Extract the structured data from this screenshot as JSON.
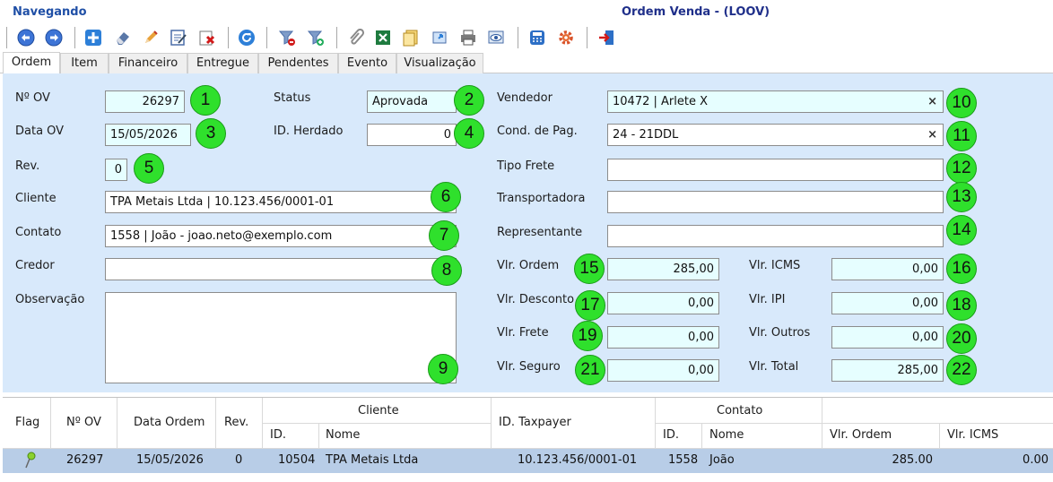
{
  "header": {
    "mode": "Navegando",
    "window_title": "Ordem Venda - (LOOV)"
  },
  "toolbar": {
    "buttons": [
      {
        "name": "back-arrow-icon"
      },
      {
        "name": "forward-arrow-icon"
      },
      {
        "name": "add-icon"
      },
      {
        "name": "eraser-icon"
      },
      {
        "name": "pencil-icon"
      },
      {
        "name": "edit-checklist-icon"
      },
      {
        "name": "delete-icon"
      },
      {
        "name": "refresh-icon"
      },
      {
        "name": "filter-remove-icon"
      },
      {
        "name": "filter-add-icon"
      },
      {
        "name": "paperclip-icon"
      },
      {
        "name": "excel-icon"
      },
      {
        "name": "documents-icon"
      },
      {
        "name": "transfer-icon"
      },
      {
        "name": "printer-icon"
      },
      {
        "name": "preview-icon"
      },
      {
        "name": "calculator-icon"
      },
      {
        "name": "gear-icon"
      },
      {
        "name": "exit-icon"
      }
    ]
  },
  "tabs": [
    "Ordem",
    "Item",
    "Financeiro",
    "Entregue",
    "Pendentes",
    "Evento",
    "Visualização"
  ],
  "form": {
    "no_ov": {
      "label": "Nº OV",
      "value": "26297",
      "badge": "1"
    },
    "status": {
      "label": "Status",
      "value": "Aprovada",
      "badge": "2"
    },
    "data_ov": {
      "label": "Data OV",
      "value": "15/05/2026",
      "badge": "3"
    },
    "id_herdado": {
      "label": "ID. Herdado",
      "value": "0",
      "badge": "4"
    },
    "rev": {
      "label": "Rev.",
      "value": "0",
      "badge": "5"
    },
    "cliente": {
      "label": "Cliente",
      "value": "TPA Metais Ltda | 10.123.456/0001-01",
      "badge": "6"
    },
    "contato": {
      "label": "Contato",
      "value": "1558 | João - joao.neto@exemplo.com",
      "badge": "7"
    },
    "credor": {
      "label": "Credor",
      "value": "",
      "badge": "8"
    },
    "observacao": {
      "label": "Observação",
      "value": "",
      "badge": "9"
    },
    "vendedor": {
      "label": "Vendedor",
      "value": "10472 | Arlete X",
      "badge": "10"
    },
    "cond_pag": {
      "label": "Cond. de Pag.",
      "value": "24 - 21DDL",
      "badge": "11"
    },
    "tipo_frete": {
      "label": "Tipo Frete",
      "value": "",
      "badge": "12"
    },
    "transportadora": {
      "label": "Transportadora",
      "value": "",
      "badge": "13"
    },
    "representante": {
      "label": "Representante",
      "value": "",
      "badge": "14"
    },
    "vlr_ordem": {
      "label": "Vlr. Ordem",
      "value": "285,00",
      "badge": "15"
    },
    "vlr_icms": {
      "label": "Vlr. ICMS",
      "value": "0,00",
      "badge": "16"
    },
    "vlr_desconto": {
      "label": "Vlr. Desconto",
      "value": "0,00",
      "badge": "17"
    },
    "vlr_ipi": {
      "label": "Vlr. IPI",
      "value": "0,00",
      "badge": "18"
    },
    "vlr_frete": {
      "label": "Vlr. Frete",
      "value": "0,00",
      "badge": "19"
    },
    "vlr_outros": {
      "label": "Vlr. Outros",
      "value": "0,00",
      "badge": "20"
    },
    "vlr_seguro": {
      "label": "Vlr. Seguro",
      "value": "0,00",
      "badge": "21"
    },
    "vlr_total": {
      "label": "Vlr. Total",
      "value": "285,00",
      "badge": "22"
    },
    "clear_symbol": "×"
  },
  "grid": {
    "headers": {
      "flag": "Flag",
      "no_ov": "Nº OV",
      "data_ordem": "Data Ordem",
      "rev": "Rev.",
      "cliente_group": "Cliente",
      "cliente_id": "ID.",
      "cliente_nome": "Nome",
      "id_taxpayer": "ID. Taxpayer",
      "contato_group": "Contato",
      "contato_id": "ID.",
      "contato_nome": "Nome",
      "vlr_ordem": "Vlr. Ordem",
      "vlr_icms": "Vlr. ICMS"
    },
    "rows": [
      {
        "no_ov": "26297",
        "data_ordem": "15/05/2026",
        "rev": "0",
        "cliente_id": "10504",
        "cliente_nome": "TPA Metais Ltda",
        "id_taxpayer": "10.123.456/0001-01",
        "contato_id": "1558",
        "contato_nome": "João",
        "vlr_ordem": "285.00",
        "vlr_icms": "0.00"
      }
    ]
  }
}
